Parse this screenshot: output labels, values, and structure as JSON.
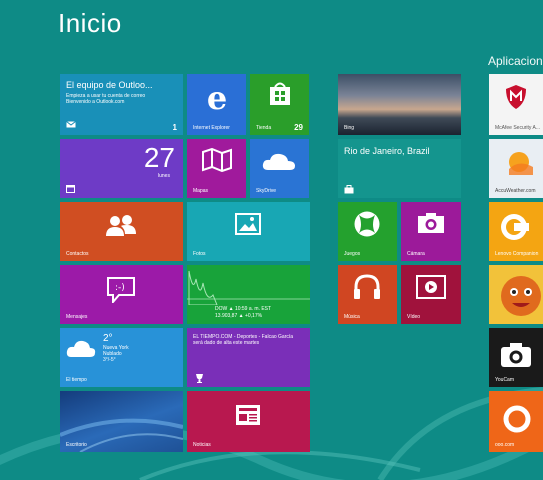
{
  "start": {
    "title": "Inicio",
    "apps_heading": "Aplicaciones"
  },
  "tiles": {
    "mail": {
      "title": "El equipo de Outloo...",
      "line1": "Empieza a usar tu cuenta de correo",
      "line2": "Bienvenido a Outlook.com",
      "count": "1"
    },
    "ie": {
      "label": "Internet Explorer"
    },
    "store": {
      "label": "Tienda",
      "count": "29"
    },
    "calendar": {
      "day": "27",
      "weekday": "lunes"
    },
    "maps": {
      "label": "Mapas"
    },
    "skydrive": {
      "label": "SkyDrive"
    },
    "contacts": {
      "label": "Contactos"
    },
    "photos": {
      "label": "Fotos"
    },
    "messaging": {
      "label": "Mensajes"
    },
    "finance": {
      "line1": "DOW ▲ 10:59 a. m. EST",
      "line2": "13.903,87 ▲ +0,17%"
    },
    "weather": {
      "temp": "2°",
      "city": "Nueva York",
      "condition": "Nublado",
      "range": "3°/-5°",
      "label": "El tiempo"
    },
    "sports": {
      "text": "EL TIEMPO.COM - Deportes - Falcao García será dado de alta este martes"
    },
    "desktop": {
      "label": "Escritorio"
    },
    "news": {
      "label": "Noticias"
    },
    "bing": {
      "label": "Bing"
    },
    "travel": {
      "title": "Rio de Janeiro, Brazil"
    },
    "games": {
      "label": "Juegos"
    },
    "camera": {
      "label": "Cámara"
    },
    "music": {
      "label": "Música"
    },
    "video": {
      "label": "Vídeo"
    },
    "mcafee": {
      "label": "McAfee Security A..."
    },
    "accuweather": {
      "label": "AccuWeather.com"
    },
    "lenovo": {
      "label": "Lenovo Companion"
    },
    "youcam": {
      "label": "YouCam"
    },
    "ooo": {
      "label": "ooo.com"
    }
  },
  "colors": {
    "background": "#0e8b86",
    "mail": "#1990b8",
    "ie": "#2a6fd6",
    "store": "#2a9e2a",
    "calendar": "#6e3bc6",
    "maps": "#a01a9c",
    "skydrive": "#2a74d4",
    "contacts": "#d04e22",
    "photos": "#18a7b4",
    "messaging": "#9c1aa8",
    "finance": "#18a33a",
    "weather": "#2892d8",
    "sports": "#7a2fb8",
    "desktop": "#2563b4",
    "news": "#b8184f",
    "travel": "#14958e",
    "games": "#24a12e",
    "camera": "#9c1a9a",
    "music": "#d04622",
    "video": "#a0123c"
  }
}
